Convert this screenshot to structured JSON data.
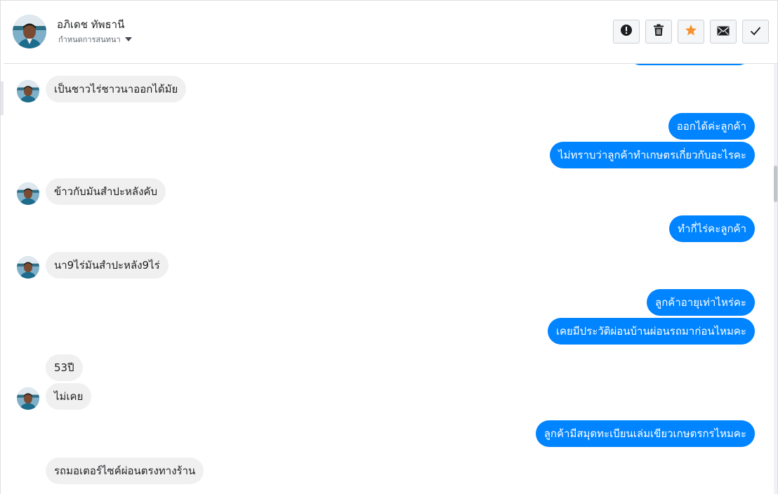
{
  "contact": {
    "name": "อภิเดช ทัพธานี",
    "subtitle": "กำหนดการสนทนา"
  },
  "toolbar": {
    "icons": [
      "alert-icon",
      "trash-icon",
      "star-icon",
      "envelope-icon",
      "checkmark-icon"
    ],
    "star_color": "#f5922f"
  },
  "colors": {
    "outgoing": "#0084ff",
    "incoming": "#f1f0f0"
  },
  "messages": [
    {
      "dir": "in",
      "text": "เป็นชาวไร่ชาวนาออกได้มัย"
    },
    {
      "dir": "out",
      "text": "ออกได้ค่ะลูกค้า"
    },
    {
      "dir": "out",
      "text": "ไม่ทราบว่าลูกค้าทำเกษตรเกี่ยวกับอะไรคะ"
    },
    {
      "dir": "in",
      "text": "ข้าวกับมันสำปะหลังคับ"
    },
    {
      "dir": "out",
      "text": "ทำกี่ไร่คะลูกค้า"
    },
    {
      "dir": "in",
      "text": "นา9ไร่มันสำปะหลัง9ไร่"
    },
    {
      "dir": "out",
      "text": "ลูกค้าอายุเท่าไหร่คะ"
    },
    {
      "dir": "out",
      "text": "เคยมีประวัติผ่อนบ้านผ่อนรถมาก่อนไหมคะ"
    },
    {
      "dir": "in",
      "text": "53ปี"
    },
    {
      "dir": "in",
      "text": "ไม่เคย"
    },
    {
      "dir": "out",
      "text": "ลูกค้ามีสมุดทะเบียนเล่มเขียวเกษตรกรไหมคะ"
    },
    {
      "dir": "in",
      "text": "รถมอเตอร์ไซค์ผ่อนตรงทางร้าน"
    }
  ]
}
